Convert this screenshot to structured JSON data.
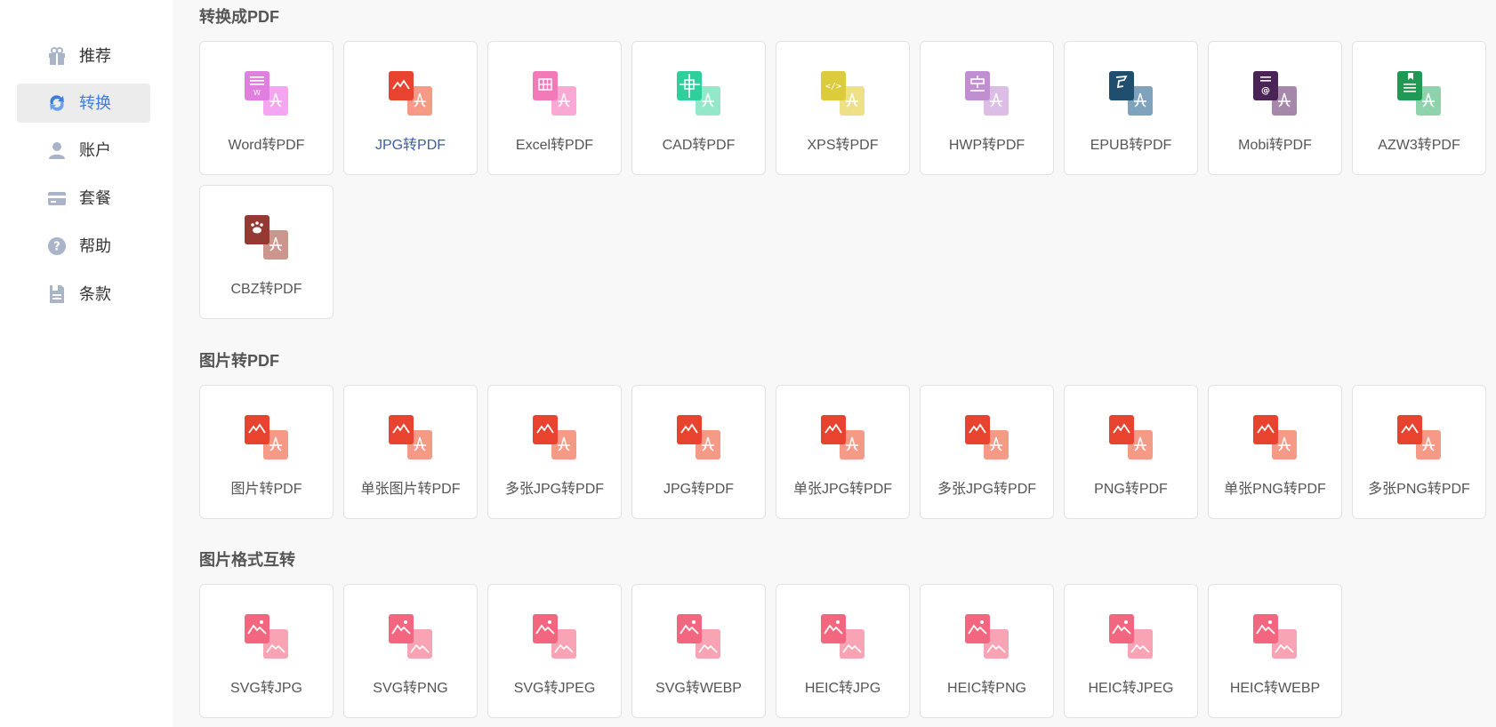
{
  "sidebar": {
    "items": [
      {
        "label": "推荐",
        "icon": "gift-icon",
        "active": false
      },
      {
        "label": "转换",
        "icon": "convert-icon",
        "active": true
      },
      {
        "label": "账户",
        "icon": "user-icon",
        "active": false
      },
      {
        "label": "套餐",
        "icon": "card-icon",
        "active": false
      },
      {
        "label": "帮助",
        "icon": "help-icon",
        "active": false
      },
      {
        "label": "条款",
        "icon": "document-icon",
        "active": false
      }
    ]
  },
  "sections": [
    {
      "title": "转换成PDF",
      "items": [
        {
          "label": "Word转PDF",
          "icon": "word-to-pdf-icon",
          "color": "#e07fe0",
          "front": "#f4a7f0",
          "glyph": "word"
        },
        {
          "label": "JPG转PDF",
          "icon": "jpg-to-pdf-icon",
          "color": "#e8432f",
          "front": "#f59a87",
          "glyph": "mountain",
          "active": true
        },
        {
          "label": "Excel转PDF",
          "icon": "excel-to-pdf-icon",
          "color": "#f27ab8",
          "front": "#f9a9d4",
          "glyph": "grid"
        },
        {
          "label": "CAD转PDF",
          "icon": "cad-to-pdf-icon",
          "color": "#2fcf9b",
          "front": "#94e8c9",
          "glyph": "cross"
        },
        {
          "label": "XPS转PDF",
          "icon": "xps-to-pdf-icon",
          "color": "#dccb3c",
          "front": "#eee087",
          "glyph": "code"
        },
        {
          "label": "HWP转PDF",
          "icon": "hwp-to-pdf-icon",
          "color": "#c28ed2",
          "front": "#dcbde6",
          "glyph": "hwp"
        },
        {
          "label": "EPUB转PDF",
          "icon": "epub-to-pdf-icon",
          "color": "#1f4e6e",
          "front": "#7fa3bd",
          "glyph": "epub"
        },
        {
          "label": "Mobi转PDF",
          "icon": "mobi-to-pdf-icon",
          "color": "#4a2456",
          "front": "#a688aa",
          "glyph": "at"
        },
        {
          "label": "AZW3转PDF",
          "icon": "azw3-to-pdf-icon",
          "color": "#1e9a55",
          "front": "#8fd3ad",
          "glyph": "lines"
        },
        {
          "label": "CBZ转PDF",
          "icon": "cbz-to-pdf-icon",
          "color": "#943a32",
          "front": "#cc968f",
          "glyph": "paw"
        }
      ]
    },
    {
      "title": "图片转PDF",
      "items": [
        {
          "label": "图片转PDF",
          "icon": "image-to-pdf-icon",
          "color": "#e8432f",
          "front": "#f59a87",
          "glyph": "mountain"
        },
        {
          "label": "单张图片转PDF",
          "icon": "single-image-to-pdf-icon",
          "color": "#e8432f",
          "front": "#f59a87",
          "glyph": "mountain"
        },
        {
          "label": "多张JPG转PDF",
          "icon": "multi-jpg-to-pdf-icon",
          "color": "#e8432f",
          "front": "#f59a87",
          "glyph": "mountain"
        },
        {
          "label": "JPG转PDF",
          "icon": "jpg-to-pdf-icon",
          "color": "#e8432f",
          "front": "#f59a87",
          "glyph": "mountain"
        },
        {
          "label": "单张JPG转PDF",
          "icon": "single-jpg-to-pdf-icon",
          "color": "#e8432f",
          "front": "#f59a87",
          "glyph": "mountain"
        },
        {
          "label": "多张JPG转PDF",
          "icon": "multi-jpg-to-pdf-icon",
          "color": "#e8432f",
          "front": "#f59a87",
          "glyph": "mountain"
        },
        {
          "label": "PNG转PDF",
          "icon": "png-to-pdf-icon",
          "color": "#e8432f",
          "front": "#f59a87",
          "glyph": "mountain"
        },
        {
          "label": "单张PNG转PDF",
          "icon": "single-png-to-pdf-icon",
          "color": "#e8432f",
          "front": "#f59a87",
          "glyph": "mountain"
        },
        {
          "label": "多张PNG转PDF",
          "icon": "multi-png-to-pdf-icon",
          "color": "#e8432f",
          "front": "#f59a87",
          "glyph": "mountain"
        }
      ]
    },
    {
      "title": "图片格式互转",
      "items": [
        {
          "label": "SVG转JPG",
          "icon": "svg-to-jpg-icon",
          "color": "#f2677f",
          "front": "#f8a4b4",
          "glyph": "pic"
        },
        {
          "label": "SVG转PNG",
          "icon": "svg-to-png-icon",
          "color": "#f2677f",
          "front": "#f8a4b4",
          "glyph": "pic"
        },
        {
          "label": "SVG转JPEG",
          "icon": "svg-to-jpeg-icon",
          "color": "#f2677f",
          "front": "#f8a4b4",
          "glyph": "pic"
        },
        {
          "label": "SVG转WEBP",
          "icon": "svg-to-webp-icon",
          "color": "#f2677f",
          "front": "#f8a4b4",
          "glyph": "pic"
        },
        {
          "label": "HEIC转JPG",
          "icon": "heic-to-jpg-icon",
          "color": "#f2677f",
          "front": "#f8a4b4",
          "glyph": "pic"
        },
        {
          "label": "HEIC转PNG",
          "icon": "heic-to-png-icon",
          "color": "#f2677f",
          "front": "#f8a4b4",
          "glyph": "pic"
        },
        {
          "label": "HEIC转JPEG",
          "icon": "heic-to-jpeg-icon",
          "color": "#f2677f",
          "front": "#f8a4b4",
          "glyph": "pic"
        },
        {
          "label": "HEIC转WEBP",
          "icon": "heic-to-webp-icon",
          "color": "#f2677f",
          "front": "#f8a4b4",
          "glyph": "pic"
        }
      ]
    }
  ],
  "colors": {
    "accent": "#3b7de0",
    "sidebar_icon": "#aab4c8"
  }
}
